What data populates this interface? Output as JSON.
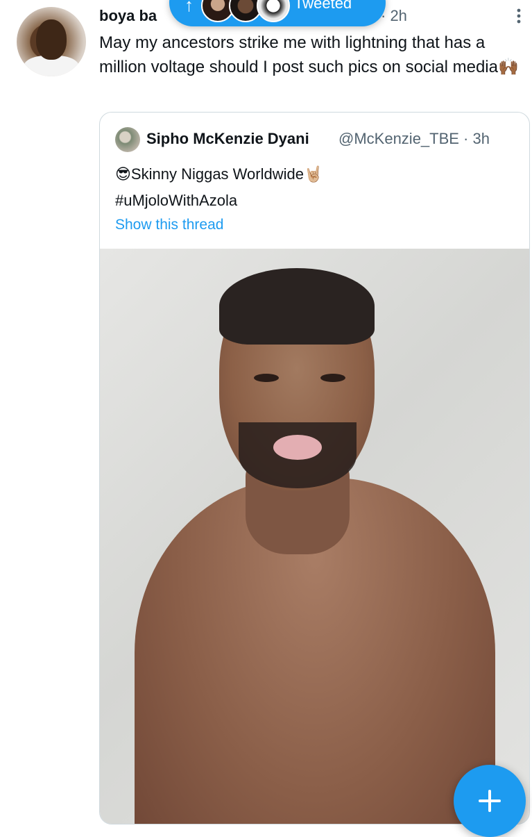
{
  "tweet": {
    "author": "boya ba",
    "time": "· 2h",
    "text": "May my ancestors strike me with lightning that has a million voltage should I post such pics on social media🙌🏾"
  },
  "pill": {
    "label": "Tweeted"
  },
  "quote": {
    "name": "Sipho McKenzie Dyani",
    "handle_time": "@McKenzie_TBE · 3h",
    "text": "😎Skinny Niggas Worldwide🤘🏼\n#uMjoloWithAzola",
    "link": "Show this thread"
  },
  "icons": {
    "more": "more-vertical-icon",
    "fab": "compose-plus-icon",
    "arrow": "arrow-up-icon"
  },
  "colors": {
    "accent": "#1d9bf0",
    "secondary_text": "#536471",
    "border": "#cfd9de"
  }
}
